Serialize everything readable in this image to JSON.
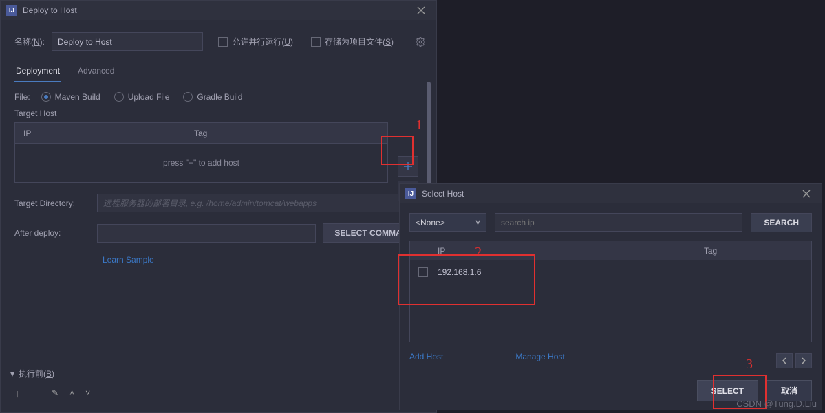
{
  "w1": {
    "title": "Deploy to Host",
    "name_label_prefix": "名称(",
    "name_label_key": "N",
    "name_label_suffix": "):",
    "name_value": "Deploy to Host",
    "allow_parallel_prefix": "允许并行运行(",
    "allow_parallel_key": "U",
    "allow_parallel_suffix": ")",
    "save_as_file_prefix": "存储为项目文件(",
    "save_as_file_key": "S",
    "save_as_file_suffix": ")",
    "tabs": {
      "deployment": "Deployment",
      "advanced": "Advanced"
    },
    "file_label": "File:",
    "file_options": {
      "maven": "Maven Build",
      "upload": "Upload File",
      "gradle": "Gradle Build"
    },
    "target_host_label": "Target Host",
    "col_ip": "IP",
    "col_tag": "Tag",
    "empty_msg": "press \"+\" to add host",
    "target_dir_label": "Target Directory:",
    "target_dir_placeholder": "远程服务器的部署目录, e.g. /home/admin/tomcat/webapps",
    "after_deploy_label": "After deploy:",
    "select_command": "SELECT COMMAND",
    "learn_sample": "Learn Sample",
    "before_run_prefix": "执行前(",
    "before_run_key": "B",
    "before_run_suffix": ")"
  },
  "w2": {
    "title": "Select Host",
    "dropdown": "<None>",
    "search_placeholder": "search ip",
    "search_btn": "SEARCH",
    "col_ip": "IP",
    "col_tag": "Tag",
    "host_ip": "192.168.1.6",
    "add_host": "Add Host",
    "manage_host": "Manage Host",
    "select": "SELECT",
    "cancel": "取消"
  },
  "anno": {
    "n1": "1",
    "n2": "2",
    "n3": "3"
  },
  "watermark": "CSDN @Tung.D.Liu"
}
